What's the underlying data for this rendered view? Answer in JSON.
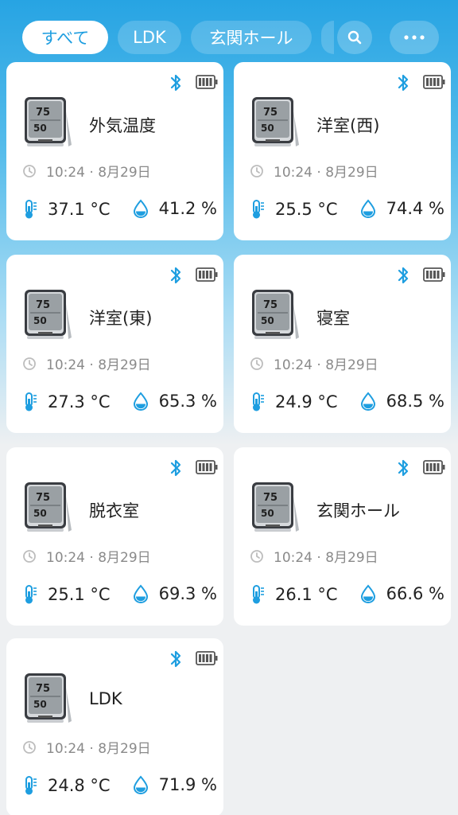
{
  "tabs": [
    {
      "label": "すべて",
      "active": true
    },
    {
      "label": "LDK",
      "active": false
    },
    {
      "label": "玄関ホール",
      "active": false
    }
  ],
  "header": {
    "search_icon": "search-icon",
    "more_icon": "more-horizontal-icon"
  },
  "colors": {
    "accent": "#1e9ee0",
    "header_top": "#27a4e3",
    "background": "#eef0f2"
  },
  "devices": [
    {
      "name": "外気温度",
      "time": "10:24 · 8月29日",
      "temperature": "37.1 °C",
      "humidity": "41.2 %"
    },
    {
      "name": "洋室(西)",
      "time": "10:24 · 8月29日",
      "temperature": "25.5 °C",
      "humidity": "74.4 %"
    },
    {
      "name": "洋室(東)",
      "time": "10:24 · 8月29日",
      "temperature": "27.3 °C",
      "humidity": "65.3 %"
    },
    {
      "name": "寝室",
      "time": "10:24 · 8月29日",
      "temperature": "24.9 °C",
      "humidity": "68.5 %"
    },
    {
      "name": "脱衣室",
      "time": "10:24 · 8月29日",
      "temperature": "25.1 °C",
      "humidity": "69.3 %"
    },
    {
      "name": "玄関ホール",
      "time": "10:24 · 8月29日",
      "temperature": "26.1 °C",
      "humidity": "66.6 %"
    },
    {
      "name": "LDK",
      "time": "10:24 · 8月29日",
      "temperature": "24.8 °C",
      "humidity": "71.9 %"
    }
  ]
}
